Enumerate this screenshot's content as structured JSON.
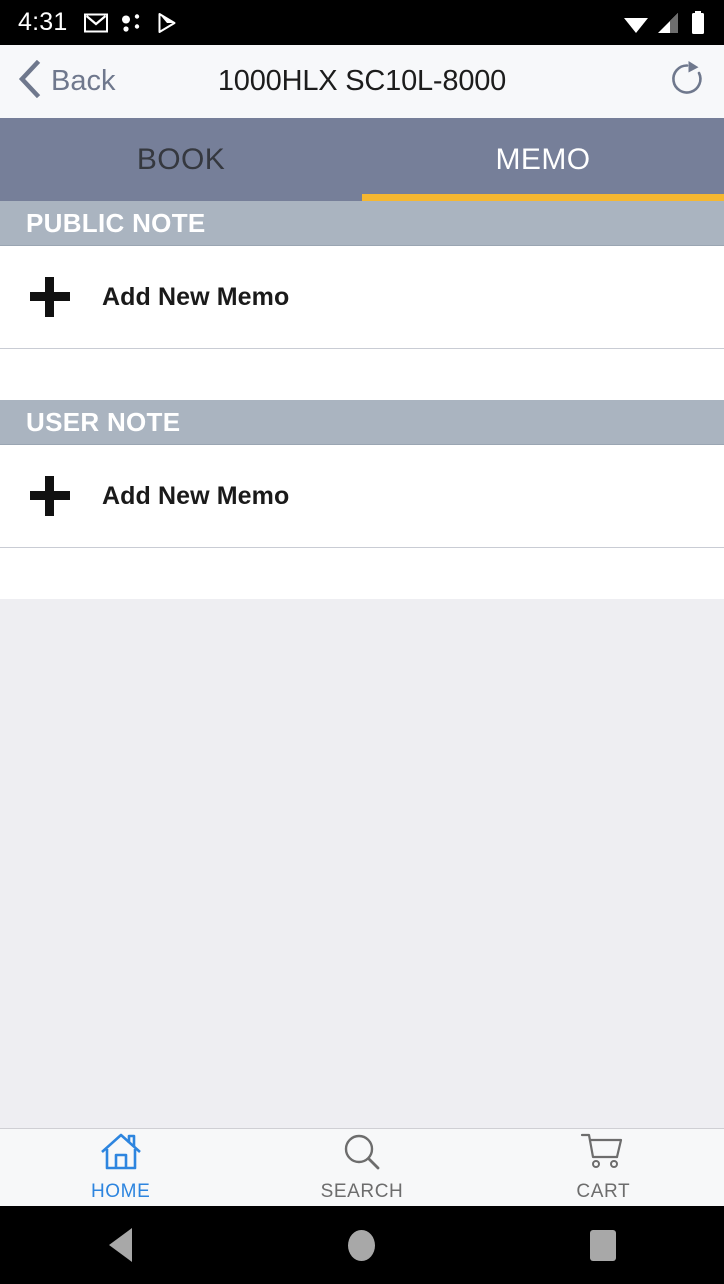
{
  "status_bar": {
    "time": "4:31",
    "left_icons": [
      "gmail-icon",
      "dots-icon",
      "play-store-icon"
    ],
    "right_icons": [
      "wifi-icon",
      "cell-signal-icon",
      "battery-icon"
    ],
    "background": "#000000"
  },
  "header": {
    "back_label": "Back",
    "title": "1000HLX SC10L-8000",
    "refresh_icon": "refresh-icon",
    "background": "#f7f8fa",
    "back_color": "#6f788d"
  },
  "tabs": {
    "background": "#767f99",
    "indicator_color": "#f5b731",
    "items": [
      {
        "label": "BOOK",
        "active": false
      },
      {
        "label": "MEMO",
        "active": true
      }
    ]
  },
  "sections": [
    {
      "header": "PUBLIC NOTE",
      "rows": [
        {
          "label": "Add New Memo",
          "icon": "plus-icon"
        }
      ]
    },
    {
      "header": "USER NOTE",
      "rows": [
        {
          "label": "Add New Memo",
          "icon": "plus-icon"
        }
      ]
    }
  ],
  "section_style": {
    "header_background": "#aab4c0",
    "header_text_color": "#ffffff",
    "row_background": "#ffffff",
    "empty_background": "#eeeef2"
  },
  "bottom_nav": {
    "background": "#f7f8f9",
    "active_color": "#2d85df",
    "idle_color": "#6d6d6d",
    "items": [
      {
        "label": "HOME",
        "icon": "home-icon",
        "active": true
      },
      {
        "label": "SEARCH",
        "icon": "search-icon",
        "active": false
      },
      {
        "label": "CART",
        "icon": "cart-icon",
        "active": false
      }
    ]
  },
  "android_nav": {
    "background": "#000000",
    "buttons": [
      {
        "name": "back",
        "icon": "triangle-back-icon"
      },
      {
        "name": "home",
        "icon": "circle-home-icon"
      },
      {
        "name": "recents",
        "icon": "square-recents-icon"
      }
    ]
  }
}
